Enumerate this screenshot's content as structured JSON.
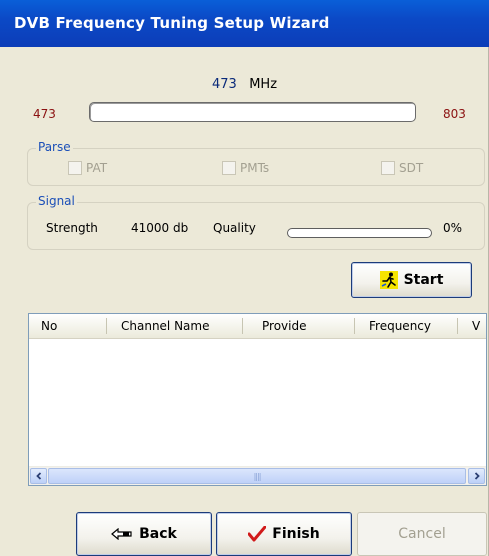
{
  "window": {
    "title": "DVB Frequency Tuning Setup Wizard"
  },
  "frequency": {
    "current": "473",
    "unit": "MHz",
    "min": "473",
    "max": "803"
  },
  "parse": {
    "legend": "Parse",
    "options": [
      {
        "label": "PAT",
        "checked": false,
        "enabled": false
      },
      {
        "label": "PMTs",
        "checked": false,
        "enabled": false
      },
      {
        "label": "SDT",
        "checked": false,
        "enabled": false
      }
    ]
  },
  "signal": {
    "legend": "Signal",
    "strength_label": "Strength",
    "strength_value": "41000 db",
    "quality_label": "Quality",
    "quality_percent": "0%"
  },
  "start_button": {
    "label": "Start",
    "icon": "running-man-icon"
  },
  "channel_list": {
    "columns": [
      "No",
      "Channel Name",
      "Provide",
      "Frequency",
      "V"
    ],
    "rows": [],
    "scrollbar": {
      "position": 0
    }
  },
  "footer": {
    "back_label": "Back",
    "finish_label": "Finish",
    "cancel_label": "Cancel"
  },
  "colors": {
    "title_bar": "#0b49c6",
    "range_label": "#8b1111",
    "legend": "#1b4fb8"
  }
}
